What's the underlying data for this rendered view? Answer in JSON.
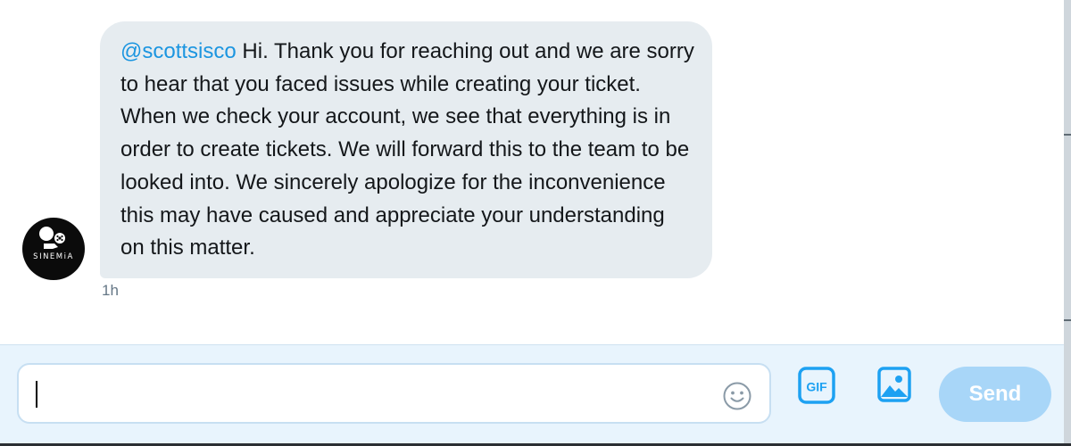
{
  "conversation": {
    "message": {
      "mention": "@scottsisco",
      "text": "Hi. Thank you for reaching out and we are sorry to hear that you faced issues while creating your ticket. When we check your account, we see that everything is in order to create tickets. We will forward this to the team to be looked into. We sincerely apologize for the inconvenience this may have caused and appreciate your understanding on this matter.",
      "timestamp": "1h"
    },
    "sender": {
      "avatar_text": "SINEMiA"
    }
  },
  "composer": {
    "input_value": "",
    "emoji_icon": "smiley-face-icon",
    "gif_label": "GIF",
    "media_icon": "image-icon",
    "send_label": "Send"
  },
  "colors": {
    "bubble_bg": "#e6ecf0",
    "mention": "#1b95e0",
    "composer_bg": "#e8f4fd",
    "icon_blue": "#1da1f2",
    "send_disabled": "#a8d6f8",
    "timestamp": "#657786"
  }
}
